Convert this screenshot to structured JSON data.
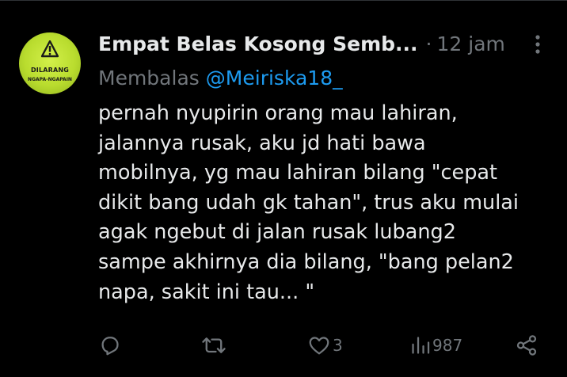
{
  "tweet": {
    "avatar": {
      "sign_line1": "DILARANG",
      "sign_line2": "NGAPA-NGAPAIN",
      "bg_color": "#c4e437"
    },
    "display_name": "Empat Belas Kosong Semb...",
    "separator": "·",
    "timestamp": "12 jam",
    "reply_prefix": "Membalas",
    "reply_to": "@Meiriska18_",
    "body_lines": [
      "pernah nyupirin orang mau lahiran,",
      "jalannya rusak, aku jd hati bawa",
      "mobilnya, yg mau lahiran bilang \"cepat",
      "dikit bang udah gk tahan\", trus aku mulai",
      "agak ngebut di jalan rusak lubang2",
      "sampe akhirnya dia bilang, \"bang pelan2",
      "napa, sakit ini tau... \""
    ],
    "actions": {
      "reply_icon": "reply-icon",
      "retweet_icon": "retweet-icon",
      "like_icon": "heart-icon",
      "like_count": "3",
      "views_icon": "views-icon",
      "views_count": "987",
      "share_icon": "share-icon"
    },
    "colors": {
      "background": "#000000",
      "text_primary": "#e7e9ea",
      "text_secondary": "#71767b",
      "link": "#1d9bf0"
    }
  }
}
